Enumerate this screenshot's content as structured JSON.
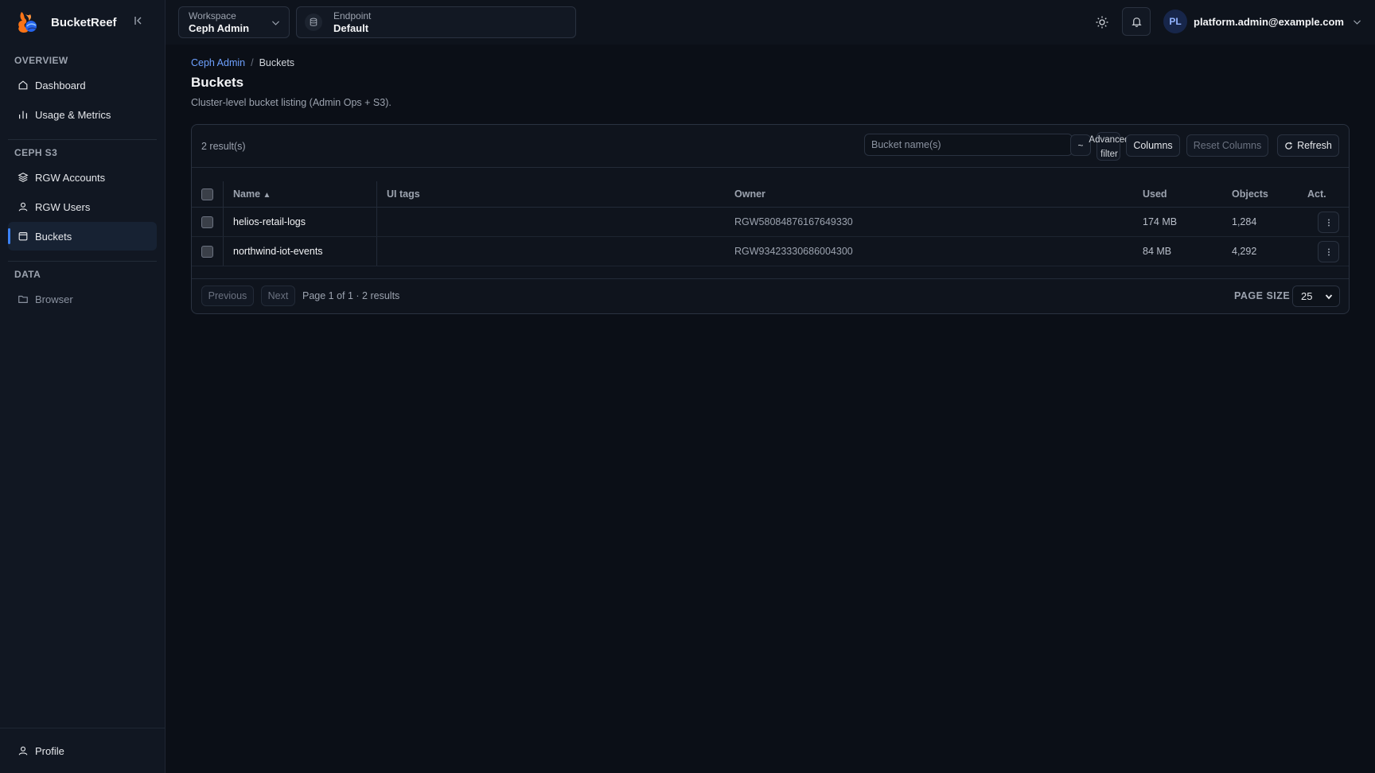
{
  "app": {
    "name": "BucketReef"
  },
  "sidebar": {
    "sections": [
      {
        "label": "OVERVIEW",
        "items": [
          {
            "label": "Dashboard",
            "icon": "home-icon"
          },
          {
            "label": "Usage & Metrics",
            "icon": "bar-chart-icon"
          }
        ]
      },
      {
        "label": "CEPH S3",
        "items": [
          {
            "label": "RGW Accounts",
            "icon": "layers-icon"
          },
          {
            "label": "RGW Users",
            "icon": "user-icon"
          },
          {
            "label": "Buckets",
            "icon": "bucket-icon",
            "active": true
          }
        ]
      },
      {
        "label": "DATA",
        "items": [
          {
            "label": "Browser",
            "icon": "folder-icon",
            "muted": true
          }
        ]
      }
    ],
    "footer": {
      "label": "Profile",
      "icon": "user-icon"
    }
  },
  "topbar": {
    "workspace": {
      "label": "Workspace",
      "value": "Ceph Admin"
    },
    "endpoint": {
      "label": "Endpoint",
      "value": "Default"
    },
    "user": {
      "initials": "PL",
      "email": "platform.admin@example.com"
    }
  },
  "breadcrumb": {
    "parent": "Ceph Admin",
    "separator": "/",
    "current": "Buckets"
  },
  "page": {
    "title": "Buckets",
    "description": "Cluster-level bucket listing (Admin Ops + S3)."
  },
  "toolbar": {
    "result_count": "2 result(s)",
    "search_placeholder": "Bucket name(s)",
    "tilde_label": "~",
    "advanced_filter_line1": "Advanced",
    "advanced_filter_line2": "filter",
    "columns_label": "Columns",
    "reset_columns_label": "Reset Columns",
    "refresh_label": "Refresh"
  },
  "table": {
    "columns": {
      "name": "Name",
      "sort_indicator": "▲",
      "ui_tags": "UI tags",
      "owner": "Owner",
      "used": "Used",
      "objects": "Objects",
      "actions": "Act."
    },
    "rows": [
      {
        "name": "helios-retail-logs",
        "ui_tags": "",
        "owner": "RGW58084876167649330",
        "used": "174 MB",
        "objects": "1,284"
      },
      {
        "name": "northwind-iot-events",
        "ui_tags": "",
        "owner": "RGW93423330686004300",
        "used": "84 MB",
        "objects": "4,292"
      }
    ]
  },
  "pagination": {
    "previous_label": "Previous",
    "next_label": "Next",
    "page_info": "Page 1 of 1 · 2 results",
    "page_size_label": "PAGE SIZE",
    "page_size_value": "25"
  },
  "colors": {
    "accent": "#3b82f6",
    "link": "#6ea1ff",
    "background": "#0b0f17",
    "sidebar": "#111722"
  }
}
